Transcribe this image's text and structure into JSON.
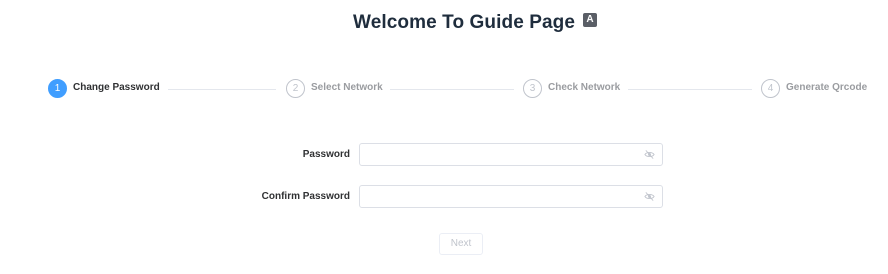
{
  "header": {
    "title": "Welcome To Guide Page",
    "lang_icon_label": "A"
  },
  "steps": [
    {
      "number": "1",
      "label": "Change Password",
      "active": true
    },
    {
      "number": "2",
      "label": "Select Network",
      "active": false
    },
    {
      "number": "3",
      "label": "Check Network",
      "active": false
    },
    {
      "number": "4",
      "label": "Generate Qrcode",
      "active": false
    }
  ],
  "form": {
    "password": {
      "label": "Password",
      "value": "",
      "placeholder": ""
    },
    "confirm_password": {
      "label": "Confirm Password",
      "value": "",
      "placeholder": ""
    }
  },
  "actions": {
    "next_label": "Next"
  },
  "colors": {
    "accent": "#409eff",
    "disabled_text": "#c0c4cc",
    "border": "#dcdfe6"
  }
}
